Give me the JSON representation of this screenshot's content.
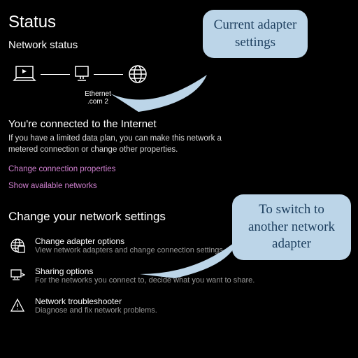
{
  "page": {
    "title": "Status",
    "subtitle": "Network status",
    "adapter_label": "Ethernet",
    "adapter_sub": ".com  2",
    "connected_heading": "You're connected to the Internet",
    "connected_desc": "If you have a limited data plan, you can make this network a metered connection or change other properties.",
    "link_change_props": "Change connection properties",
    "link_show_networks": "Show available networks",
    "settings_heading": "Change your network settings"
  },
  "options": [
    {
      "title": "Change adapter options",
      "desc": "View network adapters and change connection settings."
    },
    {
      "title": "Sharing options",
      "desc": "For the networks you connect to, decide what you want to share."
    },
    {
      "title": "Network troubleshooter",
      "desc": "Diagnose and fix network problems."
    }
  ],
  "callouts": {
    "top": "Current adapter settings",
    "bottom": "To switch to another network adapter"
  }
}
